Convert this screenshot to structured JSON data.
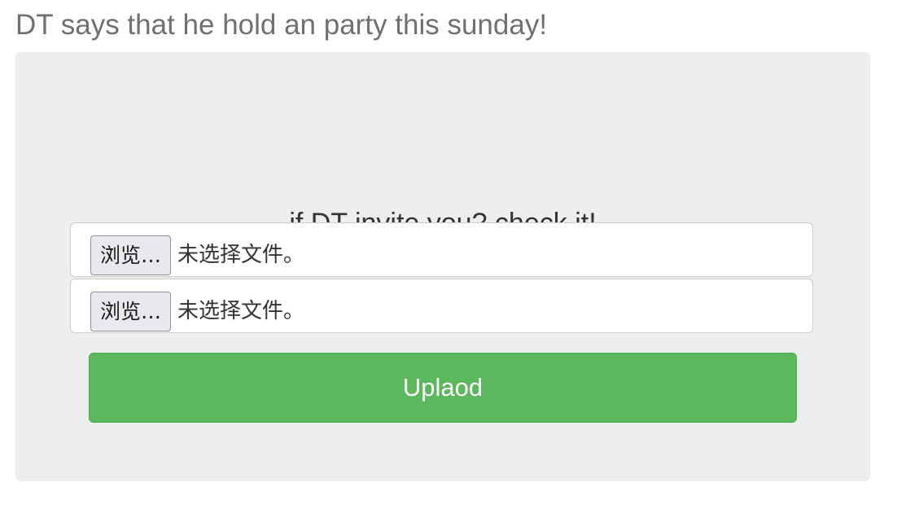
{
  "header": {
    "title": "DT says that he hold an party this sunday!"
  },
  "form": {
    "prompt": "if DT invite you? check it!",
    "file_inputs": [
      {
        "button_label": "浏览…",
        "status": "未选择文件。"
      },
      {
        "button_label": "浏览…",
        "status": "未选择文件。"
      }
    ],
    "submit_label": "Uplaod"
  },
  "colors": {
    "panel_background": "#eeeeee",
    "submit_background": "#5cb85c",
    "headline_text": "#707070"
  }
}
